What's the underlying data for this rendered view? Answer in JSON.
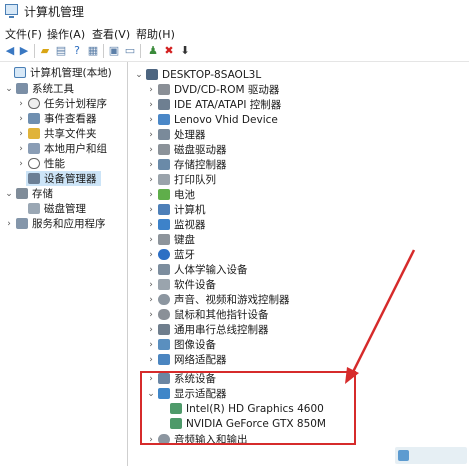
{
  "window": {
    "title": "计算机管理"
  },
  "menu": [
    "文件(F)",
    "操作(A)",
    "查看(V)",
    "帮助(H)"
  ],
  "toolbar": {
    "icons": [
      "back-icon",
      "forward-icon",
      "folder-up-icon",
      "properties-icon",
      "help-icon",
      "list-view-icon",
      "console-tree-icon",
      "scan-hardware-icon",
      "uninstall-icon",
      "disable-device-icon"
    ]
  },
  "left_tree": {
    "root": "计算机管理(本地)",
    "system_tools": "系统工具",
    "task_scheduler": "任务计划程序",
    "event_viewer": "事件查看器",
    "shared_folders": "共享文件夹",
    "local_users": "本地用户和组",
    "performance": "性能",
    "device_manager": "设备管理器",
    "storage": "存储",
    "disk_management": "磁盘管理",
    "services": "服务和应用程序"
  },
  "device_tree": {
    "computer": "DESKTOP-8SAOL3L",
    "categories": [
      "DVD/CD-ROM 驱动器",
      "IDE ATA/ATAPI 控制器",
      "Lenovo Vhid Device",
      "处理器",
      "磁盘驱动器",
      "存储控制器",
      "打印队列",
      "电池",
      "计算机",
      "监视器",
      "键盘",
      "蓝牙",
      "人体学输入设备",
      "软件设备",
      "声音、视频和游戏控制器",
      "鼠标和其他指针设备",
      "通用串行总线控制器",
      "图像设备",
      "网络适配器",
      "系统设备",
      "显示适配器"
    ],
    "display_adapters": [
      "Intel(R) HD Graphics 4600",
      "NVIDIA GeForce GTX 850M"
    ],
    "last_category": "音频输入和输出"
  }
}
